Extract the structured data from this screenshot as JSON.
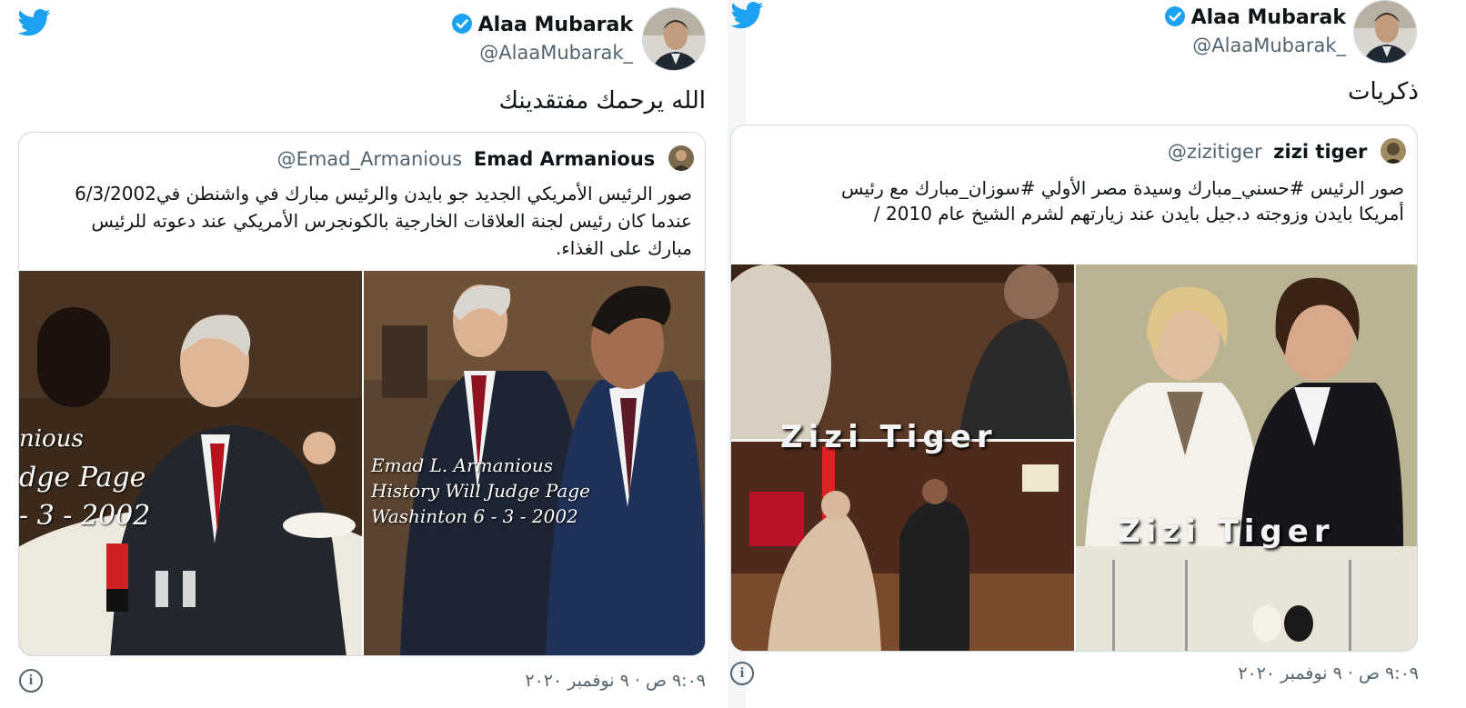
{
  "colors": {
    "twitter_blue": "#1da1f2",
    "secondary_text": "#536471",
    "border": "#cfd9de"
  },
  "left_tweet": {
    "author": {
      "name": "Alaa Mubarak",
      "handle": "@AlaaMubarak_",
      "verified": true,
      "avatar_icon": "avatar-photo"
    },
    "text": "الله يرحمك مفتقدينك",
    "quoted": {
      "author": {
        "name": "Emad Armanious",
        "handle": "@Emad_Armanious"
      },
      "text_lines": [
        "صور الرئيس الأمريكي الجديد جو بايدن والرئيس مبارك في واشنطن في6/3/2002",
        "عندما كان رئيس لجنة العلاقات الخارجية بالكونجرس الأمريكي عند دعوته للرئيس",
        "مبارك على الغذاء."
      ],
      "photo1_overlay": [
        "nious",
        "dge Page",
        "- 3 - 2002"
      ],
      "photo2_overlay": [
        "Emad L. Armanious",
        "History Will Judge Page",
        "Washinton 6 - 3 - 2002"
      ]
    },
    "timestamp": "٩:٠٩ ص · ٩ نوفمبر ٢٠٢٠"
  },
  "right_tweet": {
    "author": {
      "name": "Alaa Mubarak",
      "handle": "@AlaaMubarak_",
      "verified": true,
      "avatar_icon": "avatar-photo"
    },
    "text": "ذكريات",
    "quoted": {
      "author": {
        "name": "zizi tiger",
        "handle": "@zizitiger"
      },
      "text_lines": [
        "صور الرئيس #حسني_مبارك وسيدة مصر الأولي  #سوزان_مبارك  مع رئيس",
        "أمريكا بايدن وزوجته د.جيل بايدن  عند زيارتهم لشرم الشيخ عام 2010 /"
      ],
      "watermark": "Zizi Tiger"
    },
    "timestamp": "٩:٠٩ ص · ٩ نوفمبر ٢٠٢٠"
  }
}
